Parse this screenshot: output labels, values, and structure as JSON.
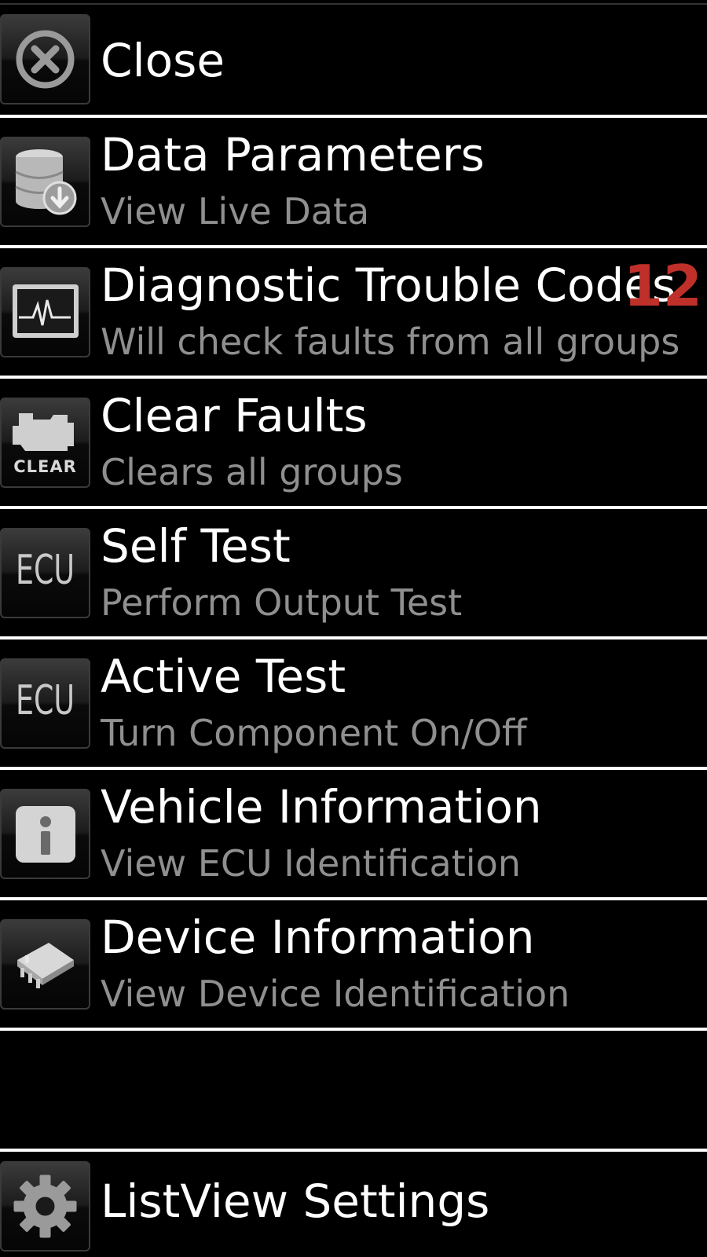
{
  "menu": {
    "items": [
      {
        "title": "Close",
        "subtitle": "",
        "icon": "close-circle-icon"
      },
      {
        "title": "Data Parameters",
        "subtitle": "View Live Data",
        "icon": "database-download-icon"
      },
      {
        "title": "Diagnostic Trouble Codes",
        "subtitle": "Will check faults from all groups",
        "icon": "monitor-pulse-icon",
        "badge": "12"
      },
      {
        "title": "Clear Faults",
        "subtitle": "Clears all groups",
        "icon": "engine-clear-icon",
        "icon_text": "CLEAR"
      },
      {
        "title": "Self Test",
        "subtitle": "Perform Output Test",
        "icon": "ecu-icon",
        "icon_text": "ECU"
      },
      {
        "title": "Active Test",
        "subtitle": "Turn Component On/Off",
        "icon": "ecu-icon",
        "icon_text": "ECU"
      },
      {
        "title": "Vehicle Information",
        "subtitle": "View ECU Identification",
        "icon": "info-icon"
      },
      {
        "title": "Device Information",
        "subtitle": "View Device Identification",
        "icon": "chip-icon"
      }
    ],
    "footer": {
      "title": "ListView Settings",
      "icon": "gear-icon"
    }
  },
  "colors": {
    "background": "#000000",
    "divider": "#ffffff",
    "title": "#ffffff",
    "subtitle": "#8f8f8f",
    "badge": "#c0302a"
  }
}
